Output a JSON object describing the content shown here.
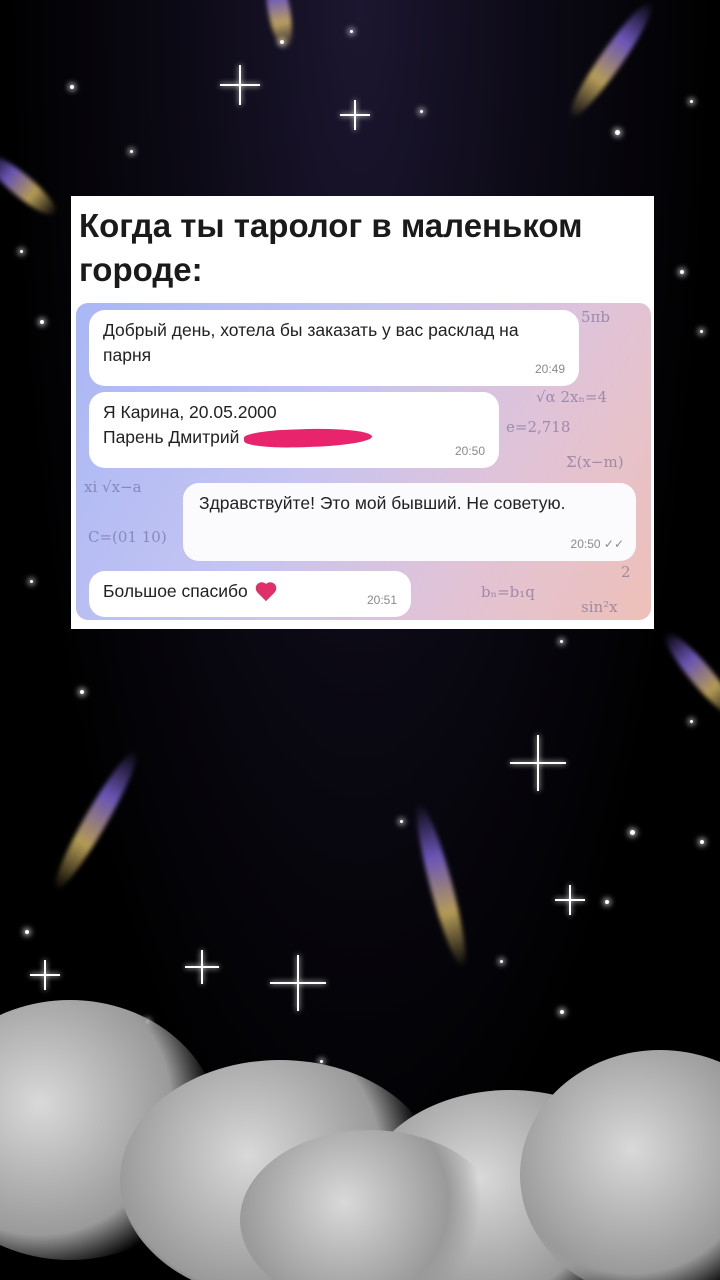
{
  "meme_title": "Когда ты таролог в маленьком городе:",
  "messages": [
    {
      "text": "Добрый день, хотела бы заказать у вас расклад на парня",
      "time": "20:49",
      "side": "left"
    },
    {
      "line1": "Я Карина, 20.05.2000",
      "line2": "Парень Дмитрий",
      "time": "20:50",
      "side": "left",
      "redacted": true
    },
    {
      "text": "Здравствуйте! Это мой бывший. Не советую.",
      "time": "20:50",
      "side": "right",
      "read_ticks": "✓✓"
    },
    {
      "text": "Большое спасибо",
      "emoji": "heart",
      "time": "20:51",
      "side": "left"
    }
  ],
  "colors": {
    "chat_bg_start": "#a9b7f5",
    "chat_bg_end": "#eec0b8",
    "redaction": "#e8246c",
    "heart": "#e0306a"
  }
}
